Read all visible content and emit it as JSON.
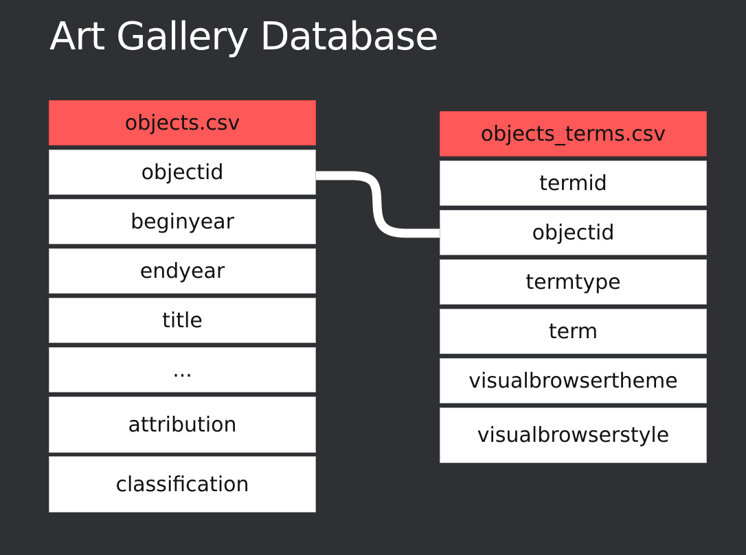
{
  "title": "Art Gallery Database",
  "colors": {
    "background": "#2f3033",
    "header": "#fe5858",
    "row": "#ffffff",
    "connector": "#ffffff"
  },
  "tables": [
    {
      "name": "objects.csv",
      "fields": [
        "objectid",
        "beginyear",
        "endyear",
        "title",
        "...",
        "attribution",
        "classification"
      ]
    },
    {
      "name": "objects_terms.csv",
      "fields": [
        "termid",
        "objectid",
        "termtype",
        "term",
        "visualbrowsertheme",
        "visualbrowserstyle"
      ]
    }
  ],
  "relationships": [
    {
      "from_table": "objects.csv",
      "from_field": "objectid",
      "to_table": "objects_terms.csv",
      "to_field": "objectid"
    }
  ]
}
